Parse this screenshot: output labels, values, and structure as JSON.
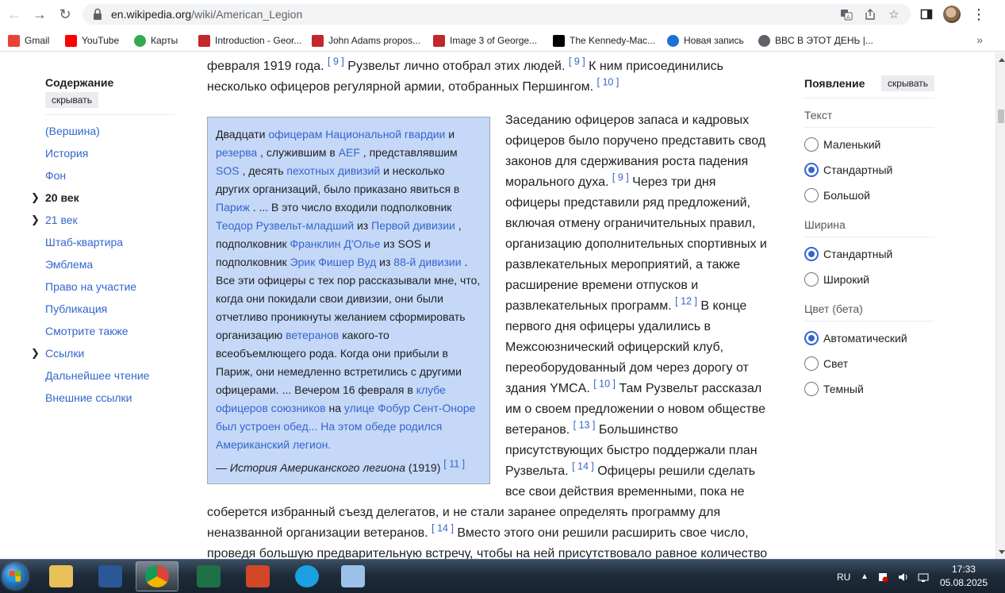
{
  "browser": {
    "url_domain": "en.wikipedia.org",
    "url_path": "/wiki/American_Legion",
    "bookmarks": [
      {
        "label": "Gmail",
        "icon": "gmail-icon",
        "color": "#ea4335"
      },
      {
        "label": "YouTube",
        "icon": "youtube-icon",
        "color": "#ff0000"
      },
      {
        "label": "Карты",
        "icon": "maps-icon",
        "color": "#34a853"
      },
      {
        "label": "Introduction - Geor...",
        "icon": "book-icon",
        "color": "#c1272d"
      },
      {
        "label": "John Adams propos...",
        "icon": "book-icon",
        "color": "#c1272d"
      },
      {
        "label": "Image 3 of George...",
        "icon": "book-icon",
        "color": "#c1272d"
      },
      {
        "label": "The Kennedy-Mac...",
        "icon": "nyt-icon",
        "color": "#000000"
      },
      {
        "label": "Новая запись",
        "icon": "shazam-icon",
        "color": "#1d70d6"
      },
      {
        "label": "BBC В ЭТОТ ДЕНЬ |...",
        "icon": "globe-icon",
        "color": "#5f6368"
      }
    ],
    "more": "»"
  },
  "toc": {
    "title": "Содержание",
    "hide": "скрывать",
    "items": [
      {
        "label": "(Вершина)",
        "bold": false,
        "expand": false
      },
      {
        "label": "История",
        "bold": false,
        "expand": false
      },
      {
        "label": "Фон",
        "bold": false,
        "expand": false
      },
      {
        "label": "20 век",
        "bold": true,
        "expand": true
      },
      {
        "label": "21 век",
        "bold": false,
        "expand": true
      },
      {
        "label": "Штаб-квартира",
        "bold": false,
        "expand": false
      },
      {
        "label": "Эмблема",
        "bold": false,
        "expand": false
      },
      {
        "label": "Право на участие",
        "bold": false,
        "expand": false
      },
      {
        "label": "Публикация",
        "bold": false,
        "expand": false
      },
      {
        "label": "Смотрите также",
        "bold": false,
        "expand": false
      },
      {
        "label": "Ссылки",
        "bold": false,
        "expand": true
      },
      {
        "label": "Дальнейшее чтение",
        "bold": false,
        "expand": false
      },
      {
        "label": "Внешние ссылки",
        "bold": false,
        "expand": false
      }
    ]
  },
  "article": {
    "top_segments": [
      {
        "t": "февраля 1919 года. ",
        "k": "text"
      },
      {
        "t": "[ 9 ]",
        "k": "cite"
      },
      {
        "t": " Рузвельт лично отобрал этих людей. ",
        "k": "text"
      },
      {
        "t": "[ 9 ]",
        "k": "cite"
      },
      {
        "t": " К ним присоединились несколько офицеров регулярной армии, отобранных Першингом. ",
        "k": "text"
      },
      {
        "t": "[ 10 ]",
        "k": "cite"
      }
    ],
    "quote_segments": [
      {
        "t": "Двадцати ",
        "k": "text"
      },
      {
        "t": "офицерам Национальной гвардии",
        "k": "link"
      },
      {
        "t": " и ",
        "k": "text"
      },
      {
        "t": "резерва",
        "k": "link"
      },
      {
        "t": " , служившим в ",
        "k": "text"
      },
      {
        "t": "AEF",
        "k": "link"
      },
      {
        "t": " , представлявшим ",
        "k": "text"
      },
      {
        "t": "SOS",
        "k": "link"
      },
      {
        "t": " , десять ",
        "k": "text"
      },
      {
        "t": "пехотных дивизий",
        "k": "link"
      },
      {
        "t": " и несколько других организаций, было приказано явиться в ",
        "k": "text"
      },
      {
        "t": "Париж",
        "k": "link"
      },
      {
        "t": " . ... В это число входили подполковник ",
        "k": "text"
      },
      {
        "t": "Теодор Рузвельт-младший",
        "k": "link"
      },
      {
        "t": " из ",
        "k": "text"
      },
      {
        "t": "Первой дивизии",
        "k": "link"
      },
      {
        "t": " , подполковник ",
        "k": "text"
      },
      {
        "t": "Франклин Д'Олье",
        "k": "link"
      },
      {
        "t": " из SOS и подполковник ",
        "k": "text"
      },
      {
        "t": "Эрик Фишер Вуд",
        "k": "link"
      },
      {
        "t": " из ",
        "k": "text"
      },
      {
        "t": "88-й дивизии",
        "k": "link"
      },
      {
        "t": " . Все эти офицеры с тех пор рассказывали мне, что, когда они покидали свои дивизии, они были отчетливо проникнуты желанием сформировать организацию ",
        "k": "text"
      },
      {
        "t": "ветеранов",
        "k": "link"
      },
      {
        "t": " какого-то всеобъемлющего рода. Когда они прибыли в Париж, они немедленно встретились с другими офицерами. ... Вечером 16 февраля в ",
        "k": "text"
      },
      {
        "t": "клубе офицеров союзников",
        "k": "link"
      },
      {
        "t": " на ",
        "k": "text"
      },
      {
        "t": "улице Фобур Сент-Оноре был устроен обед... На этом обеде родился Американский легион.",
        "k": "link"
      }
    ],
    "quote_attr_prefix": "— ",
    "quote_attr_title": "История Американского легиона",
    "quote_attr_year": " (1919) ",
    "quote_attr_cite": "[ 11 ]",
    "right_segments": [
      {
        "t": "Заседанию офицеров запаса и кадровых офицеров было поручено представить свод законов для сдерживания роста падения морального духа. ",
        "k": "text"
      },
      {
        "t": "[ 9 ]",
        "k": "cite"
      },
      {
        "t": " Через три дня офицеры представили ряд предложений, включая отмену ограничительных правил, организацию дополнительных спортивных и развлекательных мероприятий, а также расширение времени отпусков и развлекательных программ. ",
        "k": "text"
      },
      {
        "t": "[ 12 ]",
        "k": "cite"
      },
      {
        "t": " В конце первого дня офицеры удалились в Межсоюзнический офицерский клуб, переоборудованный дом через дорогу от здания YMCA. ",
        "k": "text"
      },
      {
        "t": "[ 10 ]",
        "k": "cite"
      },
      {
        "t": " Там Рузвельт рассказал им о своем предложении о новом обществе ветеранов. ",
        "k": "text"
      },
      {
        "t": "[ 13 ]",
        "k": "cite"
      },
      {
        "t": " Большинство присутствующих быстро поддержали план Рузвельта. ",
        "k": "text"
      },
      {
        "t": "[ 14 ]",
        "k": "cite"
      },
      {
        "t": " Офицеры решили сделать все свои действия временными, пока не",
        "k": "text"
      }
    ],
    "bottom_segments": [
      {
        "t": "соберется избранный съезд делегатов, и не стали заранее определять программу для неназванной организации ветеранов. ",
        "k": "text"
      },
      {
        "t": "[ 14 ]",
        "k": "cite"
      },
      {
        "t": " Вместо этого они решили расширить свое число, проведя большую предварительную встречу, чтобы на ней присутствовало равное количество",
        "k": "text"
      }
    ]
  },
  "appearance": {
    "title": "Появление",
    "hide": "скрывать",
    "sections": [
      {
        "title": "Текст",
        "options": [
          {
            "label": "Маленький",
            "checked": false
          },
          {
            "label": "Стандартный",
            "checked": true
          },
          {
            "label": "Большой",
            "checked": false
          }
        ]
      },
      {
        "title": "Ширина",
        "options": [
          {
            "label": "Стандартный",
            "checked": true
          },
          {
            "label": "Широкий",
            "checked": false
          }
        ]
      },
      {
        "title": "Цвет (бета)",
        "options": [
          {
            "label": "Автоматический",
            "checked": true
          },
          {
            "label": "Свет",
            "checked": false
          },
          {
            "label": "Темный",
            "checked": false
          }
        ]
      }
    ]
  },
  "taskbar": {
    "apps": [
      {
        "name": "file-explorer-icon",
        "color": "#e8c15a",
        "active": false
      },
      {
        "name": "word-icon",
        "color": "#2b5797",
        "active": false
      },
      {
        "name": "chrome-icon",
        "color": "#db4437",
        "active": true
      },
      {
        "name": "excel-icon",
        "color": "#1e7145",
        "active": false
      },
      {
        "name": "powerpoint-icon",
        "color": "#d24726",
        "active": false
      },
      {
        "name": "internet-explorer-icon",
        "color": "#1ba1e2",
        "active": false
      },
      {
        "name": "paint-icon",
        "color": "#9bc1e8",
        "active": false
      }
    ],
    "lang": "RU",
    "time": "17:33",
    "date": "05.08.2025"
  }
}
